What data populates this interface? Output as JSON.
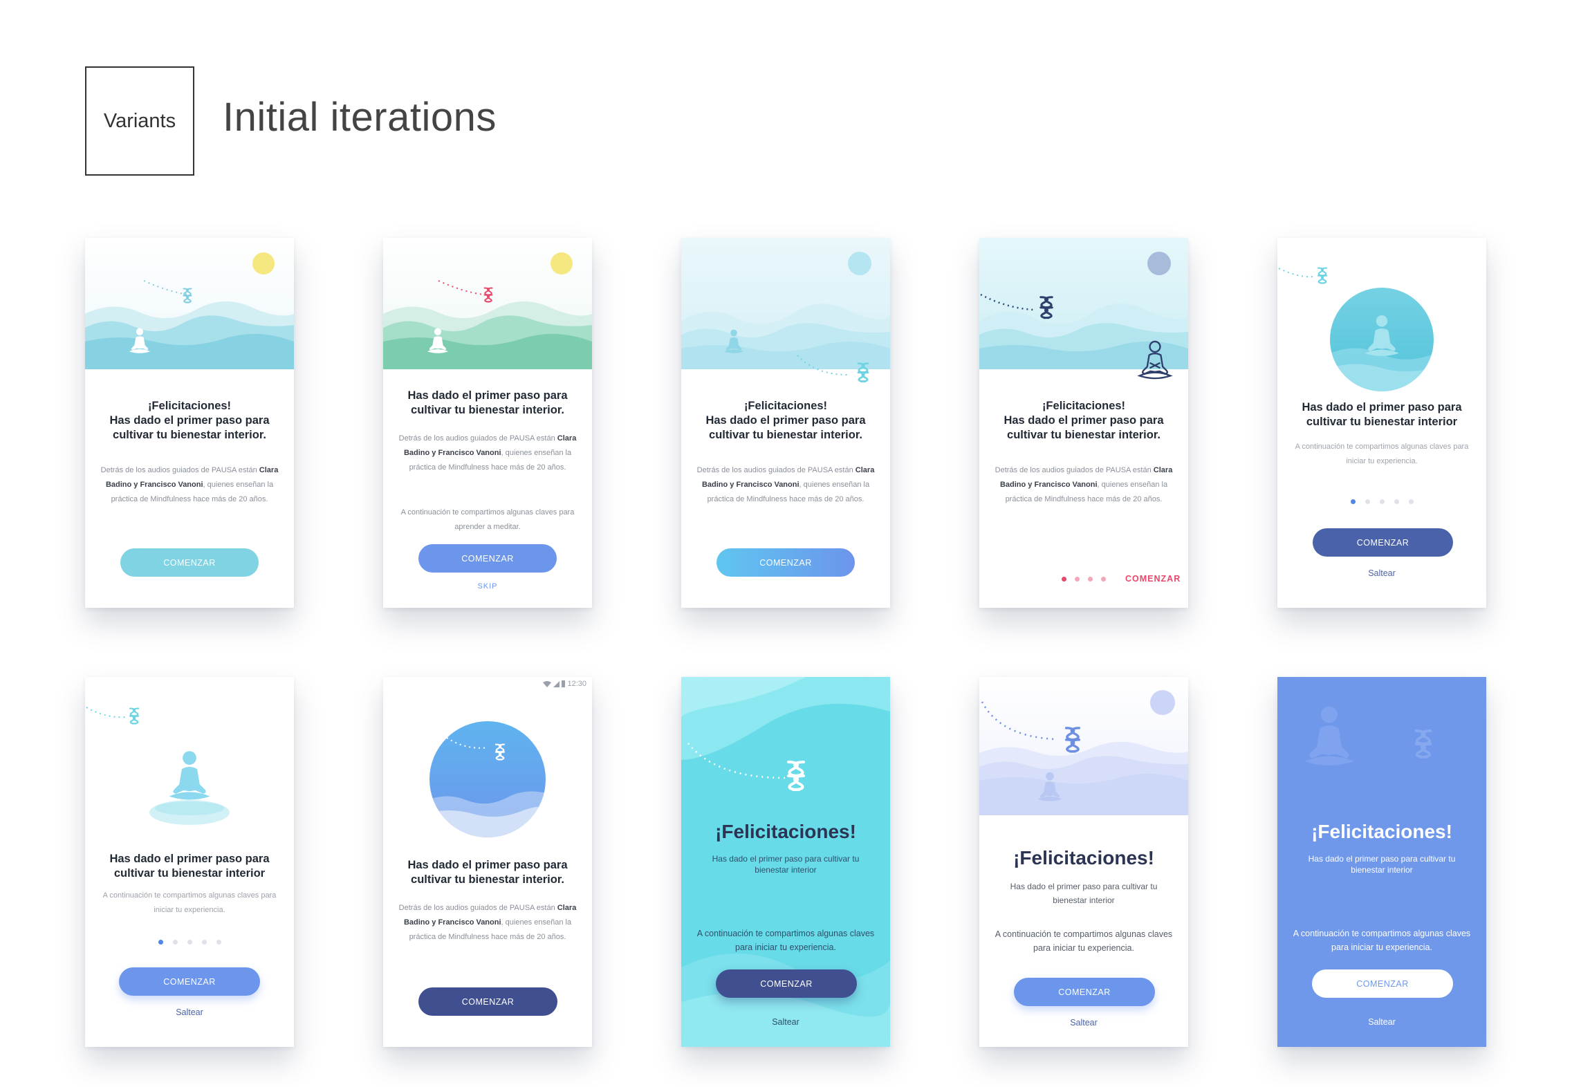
{
  "header": {
    "variants_label": "Variants",
    "title": "Initial iterations"
  },
  "status_time": "12:30",
  "cards": [
    {
      "heading": "¡Felicitaciones!\nHas dado el primer paso para\ncultivar tu bienestar interior.",
      "body": [
        "Detrás de los audios guiados de PAUSA están",
        "Clara Badino y Francisco Vanoni",
        ", quienes enseñan la práctica de Mindfulness hace más de 20 años."
      ],
      "button": "COMENZAR"
    },
    {
      "heading": "Has dado el primer paso para\ncultivar tu bienestar interior.",
      "body": [
        "Detrás de los audios guiados de PAUSA están",
        "Clara Badino y Francisco Vanoni",
        ", quienes enseñan la práctica de Mindfulness hace más de 20 años."
      ],
      "body2": "A continuación te compartimos algunas claves para aprender a meditar.",
      "button": "COMENZAR",
      "skip": "SKIP"
    },
    {
      "heading": "¡Felicitaciones!\nHas dado el primer paso para\ncultivar tu bienestar interior.",
      "body": [
        "Detrás de los audios guiados de PAUSA están",
        "Clara Badino y Francisco Vanoni",
        ", quienes enseñan la práctica de Mindfulness hace más de 20 años."
      ],
      "button": "COMENZAR"
    },
    {
      "heading": "¡Felicitaciones!\nHas dado el primer paso para\ncultivar tu bienestar interior.",
      "body": [
        "Detrás de los audios guiados de PAUSA están",
        "Clara Badino y Francisco Vanoni",
        ", quienes enseñan la práctica de Mindfulness hace más de 20 años."
      ],
      "button": "COMENZAR"
    },
    {
      "heading": "Has dado el primer paso para\ncultivar tu bienestar interior",
      "body2": "A continuación te compartimos algunas claves para iniciar tu experiencia.",
      "button": "COMENZAR",
      "skip": "Saltear"
    },
    {
      "heading": "Has dado el primer paso para\ncultivar tu bienestar interior",
      "body2": "A continuación te compartimos algunas claves para iniciar tu experiencia.",
      "button": "COMENZAR",
      "skip": "Saltear"
    },
    {
      "heading": "Has dado el primer paso para\ncultivar tu bienestar interior.",
      "body": [
        "Detrás de los audios guiados de PAUSA están",
        "Clara Badino y Francisco Vanoni",
        ", quienes enseñan la práctica de Mindfulness hace más de 20 años."
      ],
      "button": "COMENZAR"
    },
    {
      "heading": "¡Felicitaciones!",
      "sub": "Has dado el primer paso para cultivar tu bienestar interior",
      "body2": "A continuación te compartimos algunas claves para iniciar tu experiencia.",
      "button": "COMENZAR",
      "skip": "Saltear"
    },
    {
      "heading": "¡Felicitaciones!",
      "sub": "Has dado el primer paso para cultivar tu bienestar interior",
      "body2": "A continuación te compartimos algunas claves para iniciar tu experiencia.",
      "button": "COMENZAR",
      "skip": "Saltear"
    },
    {
      "heading": "¡Felicitaciones!",
      "sub": "Has dado el primer paso para cultivar tu bienestar interior",
      "body2": "A continuación te compartimos algunas claves para iniciar tu experiencia.",
      "button": "COMENZAR",
      "skip": "Saltear"
    }
  ],
  "colors": {
    "sun": "#f5e46a",
    "teal": "#7fd3e2",
    "green": "#7ccdb0",
    "blue": "#6c95ec",
    "navy": "#3f4f8f",
    "pink": "#e8486b",
    "aqua": "#68dbe8",
    "periwinkle": "#6f97ea"
  },
  "icons": [
    "pausa-logo-icon",
    "meditating-person-icon",
    "sun-icon",
    "wifi-icon",
    "signal-icon",
    "battery-icon"
  ]
}
